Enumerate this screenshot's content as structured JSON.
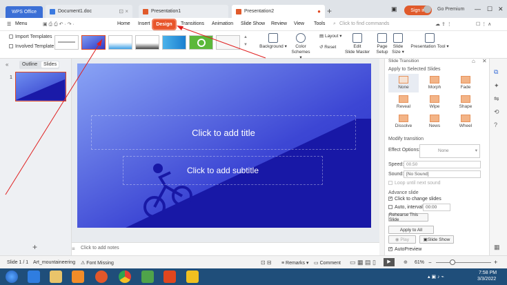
{
  "titlebar": {
    "tabs": [
      {
        "label": "WPS Office"
      },
      {
        "label": "Document1.doc"
      },
      {
        "label": "Presentation1"
      },
      {
        "label": "Presentation2"
      }
    ],
    "signin": "Sign in",
    "premium": "Go Premium"
  },
  "menubar": {
    "menu": "Menu",
    "items": [
      "Home",
      "Insert",
      "Design",
      "Transitions",
      "Animation",
      "Slide Show",
      "Review",
      "View",
      "Tools"
    ],
    "search_placeholder": "Click to find commands"
  },
  "ribbon": {
    "import_templates": "Import Templates",
    "involved_template": "Involved Template",
    "background": "Background",
    "color_schemes_1": "Color",
    "color_schemes_2": "Schemes",
    "layout": "Layout",
    "reset": "Reset",
    "edit_master_1": "Edit",
    "edit_master_2": "Slide Master",
    "page_setup_1": "Page",
    "page_setup_2": "Setup",
    "slide_size_1": "Slide",
    "slide_size_2": "Size",
    "presentation_tool": "Presentation Tool"
  },
  "left_panel": {
    "tab_outline": "Outline",
    "tab_slides": "Slides",
    "slide_number": "1"
  },
  "slide": {
    "title_placeholder": "Click to add title",
    "subtitle_placeholder": "Click to add subtitle"
  },
  "notes_placeholder": "Click to add notes",
  "transition_panel": {
    "header": "Slide Transition",
    "apply_selected": "Apply to Selected Slides",
    "effects": [
      "None",
      "Morph",
      "Fade",
      "Reveal",
      "Wipe",
      "Shape",
      "Dissolve",
      "News",
      "Wheel"
    ],
    "modify": "Modify transition",
    "effect_options_label": "Effect Options:",
    "effect_options_value": "None",
    "speed_label": "Speed:",
    "speed_value": "00.50",
    "sound_label": "Sound:",
    "sound_value": "[No Sound]",
    "loop_label": "Loop until next sound",
    "advance": "Advance slide",
    "click_change": "Click to change slides",
    "auto_interval": "Auto, interval:",
    "interval_value": "00:00",
    "rehearse": "Rehearse This Slide",
    "apply_all": "Apply to All",
    "play": "Play",
    "slide_show": "Slide Show",
    "autopreview": "AutoPreview"
  },
  "statusbar": {
    "slide_info": "Slide 1 / 1",
    "theme": "Art_mountaineering",
    "font_missing": "Font Missing",
    "remarks": "Remarks",
    "comment": "Comment",
    "zoom": "61%"
  },
  "taskbar": {
    "time": "7:58 PM",
    "date": "3/3/2022"
  },
  "colors": {
    "accent": "#e8542a",
    "slide_blue": "#2a35c4",
    "slide_dark": "#1a1aa8"
  }
}
